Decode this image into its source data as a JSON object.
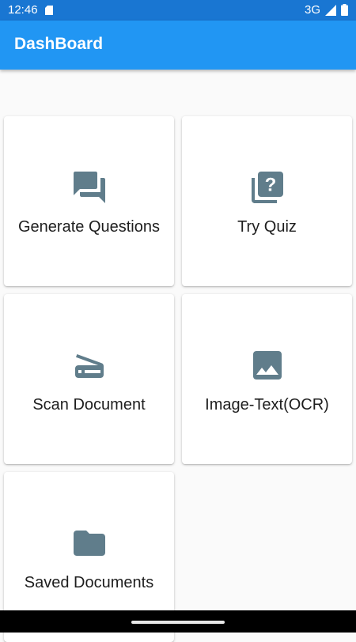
{
  "status_bar": {
    "time": "12:46",
    "network": "3G"
  },
  "app_bar": {
    "title": "DashBoard"
  },
  "cards": [
    {
      "label": "Generate Questions",
      "icon": "forum-icon"
    },
    {
      "label": "Try Quiz",
      "icon": "quiz-icon"
    },
    {
      "label": "Scan Document",
      "icon": "scanner-icon"
    },
    {
      "label": "Image-Text(OCR)",
      "icon": "image-icon"
    },
    {
      "label": "Saved Documents",
      "icon": "folder-icon"
    }
  ],
  "colors": {
    "status_bar": "#1976d2",
    "app_bar": "#2196f3",
    "icon": "#607d8b",
    "background": "#fafafa"
  }
}
